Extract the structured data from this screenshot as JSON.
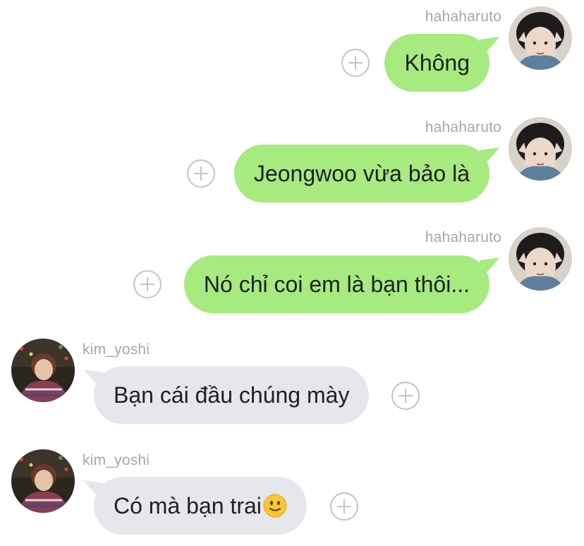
{
  "messages": [
    {
      "direction": "outgoing",
      "username": "hahaharuto",
      "text": "Không"
    },
    {
      "direction": "outgoing",
      "username": "hahaharuto",
      "text": "Jeongwoo vừa bảo là"
    },
    {
      "direction": "outgoing",
      "username": "hahaharuto",
      "text": "Nó chỉ coi em là bạn thôi..."
    },
    {
      "direction": "incoming",
      "username": "kim_yoshi",
      "text": "Bạn cái đầu chúng mày"
    },
    {
      "direction": "incoming",
      "username": "kim_yoshi",
      "text": "Có mà bạn trai",
      "emoji": "slightly-smiling-face-icon"
    }
  ],
  "colors": {
    "outgoing_bubble": "#a6ea80",
    "incoming_bubble": "#e6e7ec",
    "username": "#a7a7a7",
    "plus_icon": "#c4c4c4"
  }
}
